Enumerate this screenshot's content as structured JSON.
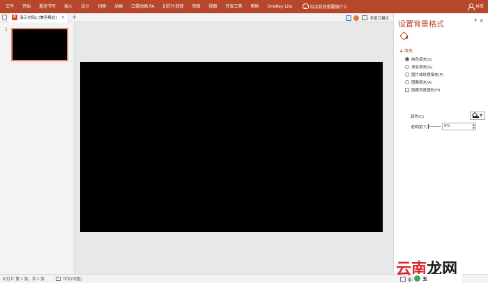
{
  "ribbon": {
    "tabs": [
      "文件",
      "开始",
      "墨迹书写",
      "插入",
      "设计",
      "切换",
      "动画",
      "口袋动画 PA",
      "幻灯片放映",
      "审阅",
      "视图",
      "开发工具",
      "帮助",
      "OneKey Lite"
    ],
    "tell_me": "告诉我你想要做什么",
    "share": "共享"
  },
  "docbar": {
    "doc_title": "演示文稿1 [兼容模式]",
    "close_glyph": "×",
    "add_glyph": "+",
    "multi_window": "多窗口模式"
  },
  "thumbnails": {
    "slide_number": "1"
  },
  "pane": {
    "title": "设置背景格式",
    "caret": "▾",
    "close": "×",
    "section": "填充",
    "section_glyph": "◢",
    "options": {
      "solid": "纯色填充(S)",
      "gradient": "渐变填充(G)",
      "picture": "图片或纹理填充(P)",
      "pattern": "图案填充(A)"
    },
    "hide_graphics": "隐藏背景图形(H)",
    "color_label": "颜色(C)",
    "transparency_label": "透明度(T)",
    "transparency_value": "0%",
    "selected_fill": "solid",
    "color_value": "#000000"
  },
  "status": {
    "slide_info": "幻灯片 第 1 张，共 1 张",
    "language": "中文(中国)",
    "notes": "备注",
    "comments": "批注"
  },
  "watermark": {
    "brand_part1": "云南",
    "brand_part2": "龙网",
    "sub": "五"
  },
  "colors": {
    "accent": "#b7472a",
    "slide_background": "#000000"
  }
}
